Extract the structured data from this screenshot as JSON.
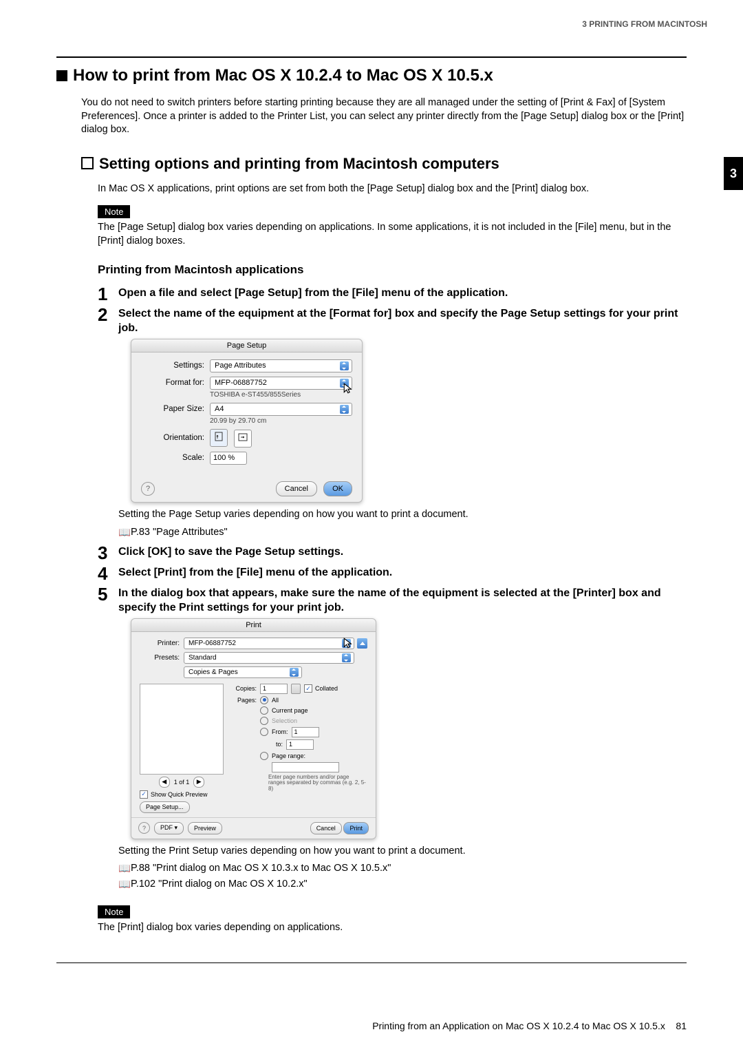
{
  "header": {
    "running": "3 PRINTING FROM MACINTOSH"
  },
  "sideTab": "3",
  "h1": "How to print from Mac OS X 10.2.4 to Mac OS X 10.5.x",
  "intro": "You do not need to switch printers before starting printing because they are all managed under the setting of [Print & Fax] of [System Preferences]. Once a printer is added to the Printer List, you can select any printer directly from the [Page Setup] dialog box or the [Print] dialog box.",
  "h2": "Setting options and printing from Macintosh computers",
  "p1": "In Mac OS X applications, print options are set from both the [Page Setup] dialog box and the [Print] dialog box.",
  "note1": {
    "label": "Note",
    "text": "The [Page Setup] dialog box varies depending on applications. In some applications, it is not included in the [File] menu, but in the [Print] dialog boxes."
  },
  "h3": "Printing from Macintosh applications",
  "steps": {
    "s1": "Open a file and select [Page Setup] from the [File] menu of the application.",
    "s2": "Select the name of the equipment at the [Format for] box and specify the Page Setup settings for your print job.",
    "s2body1": "Setting the Page Setup varies depending on how you want to print a document.",
    "s2ref": "P.83 \"Page Attributes\"",
    "s3": "Click [OK] to save the Page Setup settings.",
    "s4": "Select [Print] from the [File] menu of the application.",
    "s5": "In the dialog box that appears, make sure the name of the equipment is selected at the [Printer] box and specify the Print settings for your print job.",
    "s5body1": "Setting the Print Setup varies depending on how you want to print a document.",
    "s5ref1": "P.88 \"Print dialog on Mac OS X 10.3.x to Mac OS X 10.5.x\"",
    "s5ref2": "P.102 \"Print dialog on Mac OS X 10.2.x\""
  },
  "note2": {
    "label": "Note",
    "text": "The [Print] dialog box varies depending on applications."
  },
  "pagesetup": {
    "title": "Page Setup",
    "settingsLabel": "Settings:",
    "settingsValue": "Page Attributes",
    "formatForLabel": "Format for:",
    "formatForValue": "MFP-06887752",
    "formatForSub": "TOSHIBA e-ST455/855Series",
    "paperSizeLabel": "Paper Size:",
    "paperSizeValue": "A4",
    "paperSizeSub": "20.99 by 29.70 cm",
    "orientationLabel": "Orientation:",
    "scaleLabel": "Scale:",
    "scaleValue": "100",
    "scaleUnit": "%",
    "cancel": "Cancel",
    "ok": "OK"
  },
  "print": {
    "title": "Print",
    "printerLabel": "Printer:",
    "printerValue": "MFP-06887752",
    "presetsLabel": "Presets:",
    "presetsValue": "Standard",
    "section": "Copies & Pages",
    "copiesLabel": "Copies:",
    "copiesValue": "1",
    "collated": "Collated",
    "pagesLabel": "Pages:",
    "all": "All",
    "currentPage": "Current page",
    "selection": "Selection",
    "from": "From:",
    "fromVal": "1",
    "to": "to:",
    "toVal": "1",
    "pageRange": "Page range:",
    "hint": "Enter page numbers and/or page ranges separated by commas (e.g. 2, 5-8)",
    "navText": "1 of 1",
    "showQuick": "Show Quick Preview",
    "pageSetupBtn": "Page Setup...",
    "pdf": "PDF ▾",
    "preview": "Preview",
    "cancel": "Cancel",
    "printBtn": "Print"
  },
  "footer": {
    "text": "Printing from an Application on Mac OS X 10.2.4 to Mac OS X 10.5.x",
    "page": "81"
  }
}
